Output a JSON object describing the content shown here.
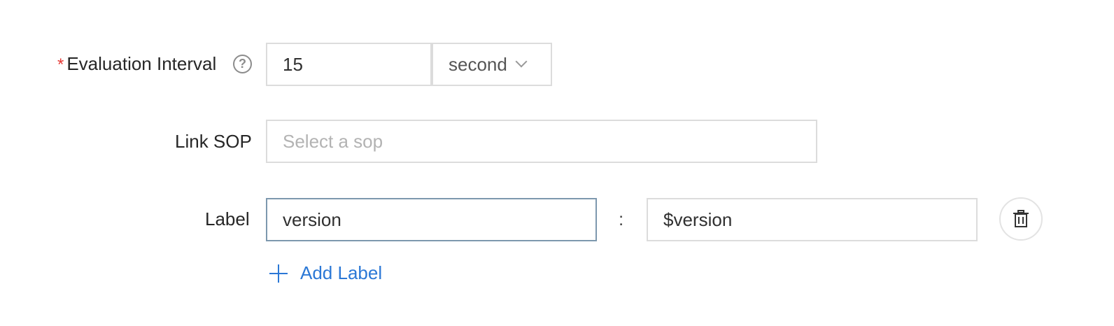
{
  "evaluation_interval": {
    "required_mark": "*",
    "label": "Evaluation Interval",
    "help_icon_glyph": "?",
    "value": "15",
    "unit": "second"
  },
  "link_sop": {
    "label": "Link SOP",
    "placeholder": "Select a sop"
  },
  "label_row": {
    "label": "Label",
    "key": "version",
    "separator": ":",
    "value": "$version"
  },
  "add_label": {
    "text": "Add Label"
  },
  "colors": {
    "required": "#e53935",
    "link": "#2b78d6",
    "focused_border": "#7d98ae"
  }
}
